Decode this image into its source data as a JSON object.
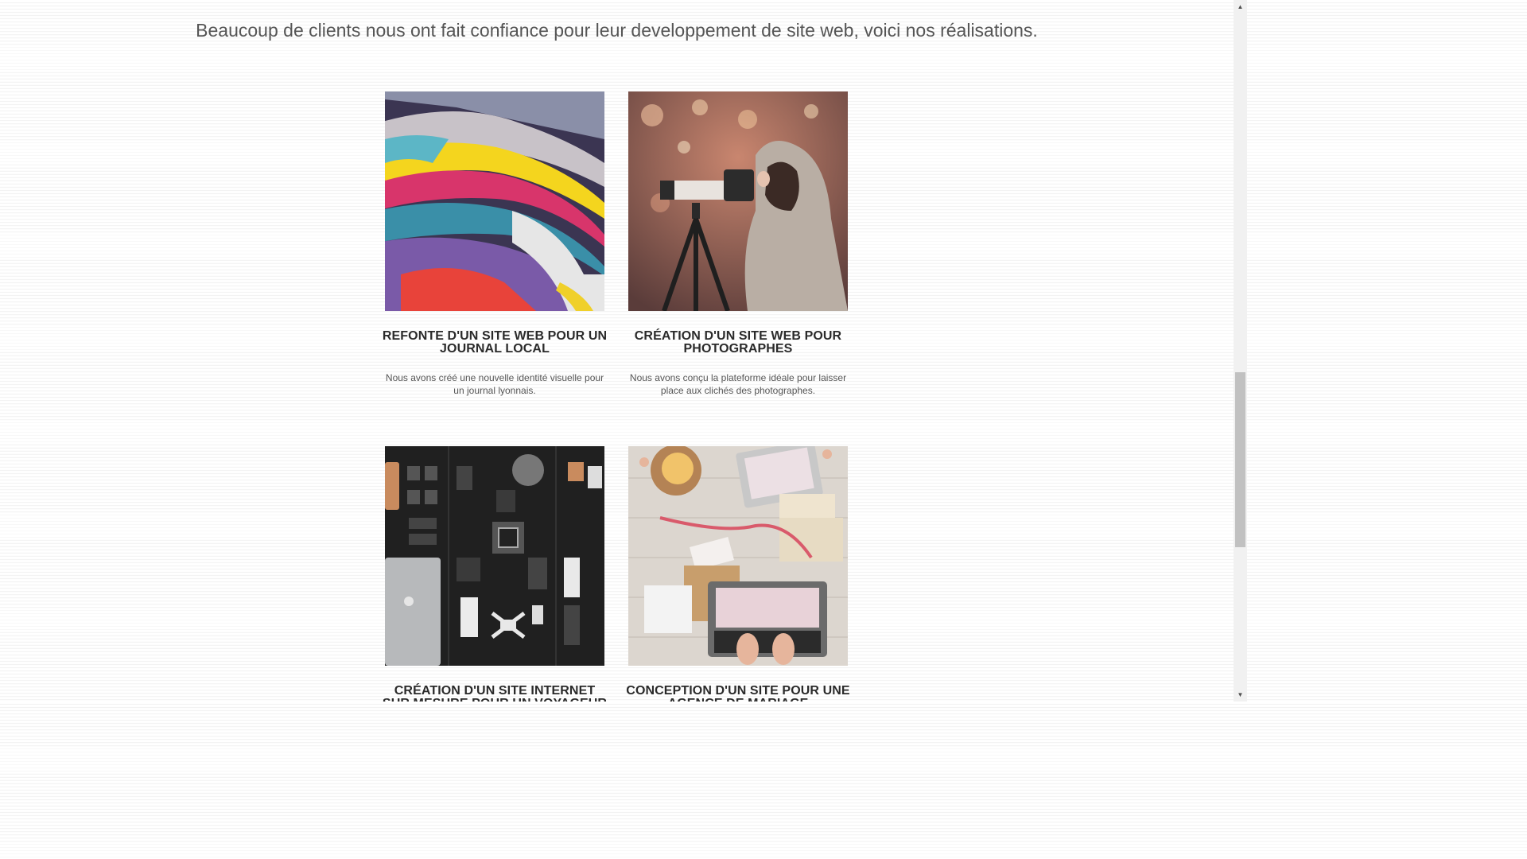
{
  "intro_text": "Beaucoup de clients nous ont fait confiance pour leur developpement de site web, voici nos réalisations.",
  "projects": [
    {
      "image_icon": "magazines-image",
      "title": "Refonte d'un site web pour un journal local",
      "description": "Nous avons créé une nouvelle identité visuelle pour un journal lyonnais."
    },
    {
      "image_icon": "photographer-image",
      "title": "Création d'un site web pour photographes",
      "description": "Nous avons conçu la plateforme idéale pour laisser place aux clichés des photographes."
    },
    {
      "image_icon": "travel-gear-image",
      "title": "Création d'un site internet sur mesure pour un voyageur",
      "description": ""
    },
    {
      "image_icon": "wedding-desk-image",
      "title": "Conception d'un site pour une agence de mariage",
      "description": ""
    }
  ],
  "scrollbar": {
    "up_icon": "arrow-up-icon",
    "down_icon": "arrow-down-icon",
    "position_fraction": 0.53
  }
}
